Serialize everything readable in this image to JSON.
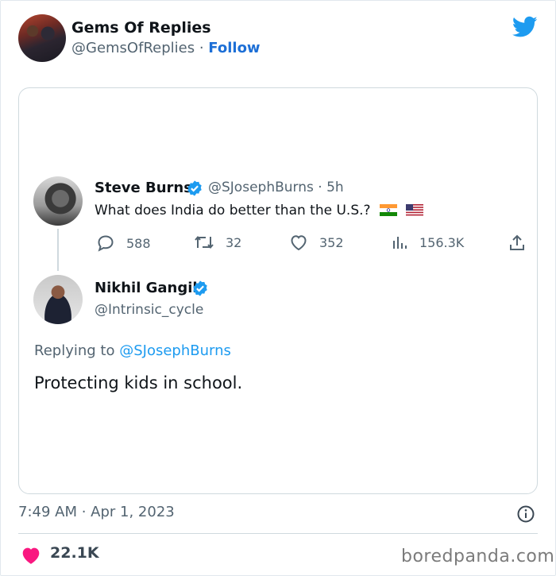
{
  "header": {
    "name": "Gems Of Replies",
    "handle": "@GemsOfReplies",
    "separator": "·",
    "follow_label": "Follow"
  },
  "quoted": {
    "author": {
      "name": "Steve Burns",
      "handle": "@SJosephBurns",
      "time": "5h"
    },
    "text": "What does India do better than the U.S.?",
    "stats": {
      "replies": "588",
      "retweets": "32",
      "likes": "352",
      "views": "156.3K"
    }
  },
  "reply": {
    "author": {
      "name": "Nikhil Gangil",
      "handle": "@Intrinsic_cycle"
    },
    "replying_prefix": "Replying to",
    "replying_to": "@SJosephBurns",
    "text": "Protecting kids in school."
  },
  "footer": {
    "timestamp": "7:49 AM · Apr 1, 2023",
    "like_count": "22.1K",
    "watermark": "boredpanda.com"
  },
  "colors": {
    "twitter_blue": "#1d9bf0",
    "follow_blue": "#1d6fd6",
    "heart_pink": "#f91880",
    "muted_text": "#536471"
  }
}
